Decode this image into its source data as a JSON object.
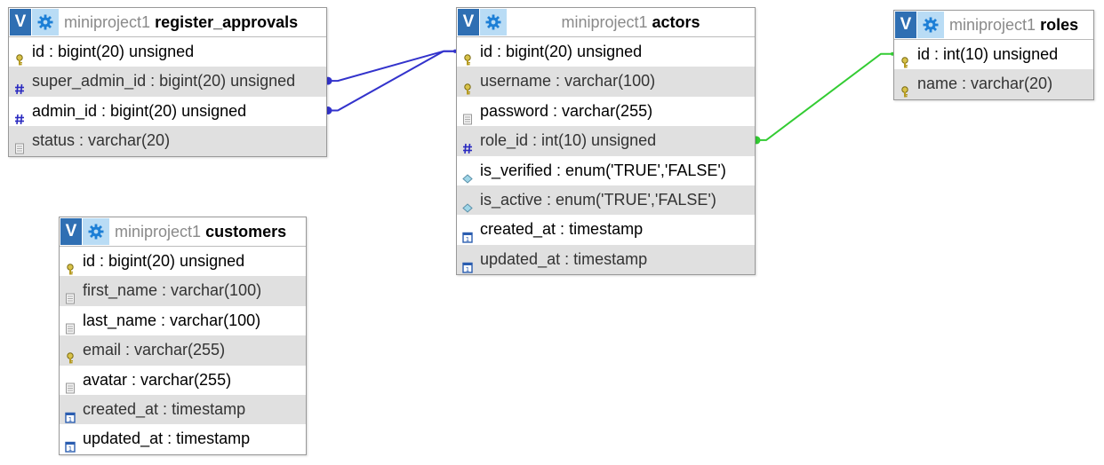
{
  "colors": {
    "link_blue": "#3333cc",
    "link_green": "#33cc33",
    "toggle_bg": "#2f6fb3",
    "config_bg": "#b9dcf5",
    "alt_row": "#e0e0e0"
  },
  "tables": [
    {
      "key": "register_approvals",
      "db": "miniproject1",
      "name": "register_approvals",
      "toggle_label": "V",
      "columns": [
        {
          "text": "id : bigint(20) unsigned",
          "icon": "primary-key-icon"
        },
        {
          "text": "super_admin_id : bigint(20) unsigned",
          "icon": "hash-icon"
        },
        {
          "text": "admin_id : bigint(20) unsigned",
          "icon": "hash-icon"
        },
        {
          "text": "status : varchar(20)",
          "icon": "text-field-icon"
        }
      ]
    },
    {
      "key": "actors",
      "db": "miniproject1",
      "name": "actors",
      "toggle_label": "V",
      "columns": [
        {
          "text": "id : bigint(20) unsigned",
          "icon": "primary-key-icon"
        },
        {
          "text": "username : varchar(100)",
          "icon": "primary-key-icon"
        },
        {
          "text": "password : varchar(255)",
          "icon": "text-field-icon"
        },
        {
          "text": "role_id : int(10) unsigned",
          "icon": "hash-icon"
        },
        {
          "text": "is_verified : enum('TRUE','FALSE')",
          "icon": "enum-icon"
        },
        {
          "text": "is_active : enum('TRUE','FALSE')",
          "icon": "enum-icon"
        },
        {
          "text": "created_at : timestamp",
          "icon": "calendar-icon"
        },
        {
          "text": "updated_at : timestamp",
          "icon": "calendar-icon"
        }
      ]
    },
    {
      "key": "roles",
      "db": "miniproject1",
      "name": "roles",
      "toggle_label": "V",
      "columns": [
        {
          "text": "id : int(10) unsigned",
          "icon": "primary-key-icon"
        },
        {
          "text": "name : varchar(20)",
          "icon": "primary-key-icon"
        }
      ]
    },
    {
      "key": "customers",
      "db": "miniproject1",
      "name": "customers",
      "toggle_label": "V",
      "columns": [
        {
          "text": "id : bigint(20) unsigned",
          "icon": "primary-key-icon"
        },
        {
          "text": "first_name : varchar(100)",
          "icon": "text-field-icon"
        },
        {
          "text": "last_name : varchar(100)",
          "icon": "text-field-icon"
        },
        {
          "text": "email : varchar(255)",
          "icon": "primary-key-icon"
        },
        {
          "text": "avatar : varchar(255)",
          "icon": "text-field-icon"
        },
        {
          "text": "created_at : timestamp",
          "icon": "calendar-icon"
        },
        {
          "text": "updated_at : timestamp",
          "icon": "calendar-icon"
        }
      ]
    }
  ],
  "relations": [
    {
      "from_table": "register_approvals",
      "from_row": 1,
      "to_table": "actors",
      "to_row": 0,
      "color": "#3333cc"
    },
    {
      "from_table": "register_approvals",
      "from_row": 2,
      "to_table": "actors",
      "to_row": 0,
      "color": "#3333cc"
    },
    {
      "from_table": "actors",
      "from_row": 3,
      "to_table": "roles",
      "to_row": 0,
      "color": "#33cc33"
    }
  ]
}
